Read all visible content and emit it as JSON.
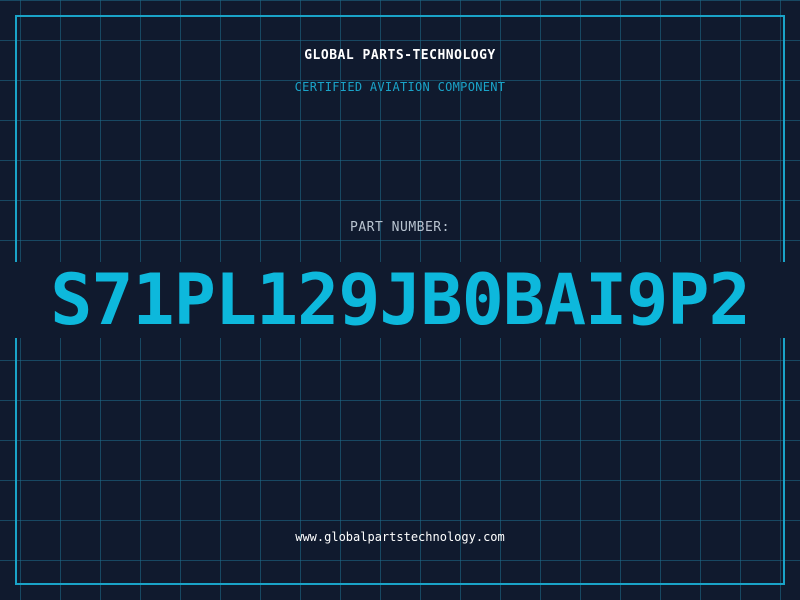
{
  "colors": {
    "background": "#101a2e",
    "grid": "#1e6e8c",
    "accent": "#1aa3c8",
    "part_number": "#0db8dc",
    "brand_text": "#ffffff",
    "label_text": "#b9c4d0"
  },
  "header": {
    "brand": "GLOBAL PARTS-TECHNOLOGY",
    "tagline": "CERTIFIED AVIATION COMPONENT"
  },
  "part": {
    "label": "PART NUMBER:",
    "number": "S71PL129JB0BAI9P2"
  },
  "footer": {
    "url": "www.globalpartstechnology.com"
  }
}
